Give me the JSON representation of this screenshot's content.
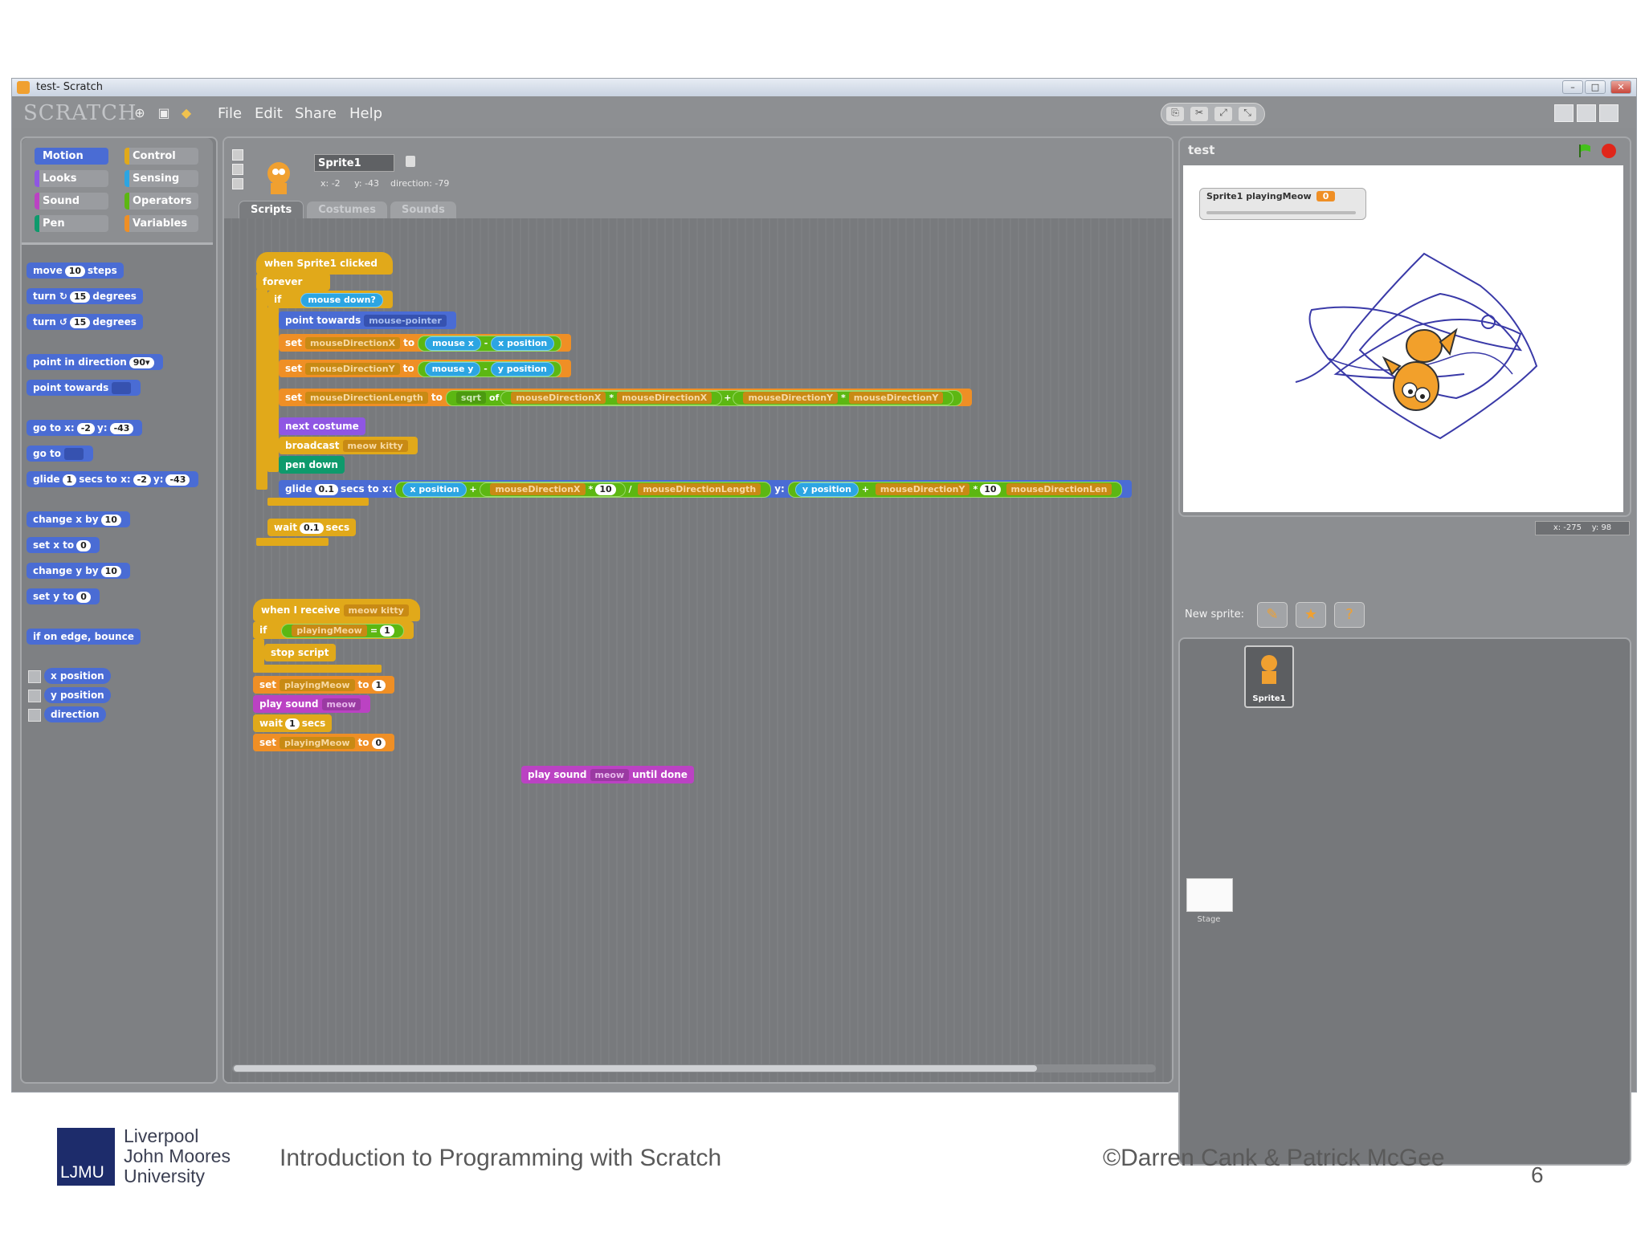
{
  "window": {
    "title": "test- Scratch"
  },
  "menubar": {
    "logo": "SCRATCH",
    "items": [
      "File",
      "Edit",
      "Share",
      "Help"
    ]
  },
  "categories": {
    "motion": "Motion",
    "control": "Control",
    "looks": "Looks",
    "sensing": "Sensing",
    "sound": "Sound",
    "operators": "Operators",
    "pen": "Pen",
    "variables": "Variables"
  },
  "palette": {
    "move": "move",
    "move_val": "10",
    "move_end": "steps",
    "turn_r": "turn ↻",
    "turn_r_val": "15",
    "turn_r_end": "degrees",
    "turn_l": "turn ↺",
    "turn_l_val": "15",
    "turn_l_end": "degrees",
    "point_dir": "point in direction",
    "point_dir_val": "90▾",
    "point_towards": "point towards",
    "goto": "go to x:",
    "goto_x": "-2",
    "goto_y_lbl": "y:",
    "goto_y": "-43",
    "goto_obj": "go to",
    "glide": "glide",
    "glide_secs": "1",
    "glide_mid": "secs to x:",
    "glide_x": "-2",
    "glide_y_lbl": "y:",
    "glide_y": "-43",
    "change_x": "change x by",
    "change_x_val": "10",
    "set_x": "set x to",
    "set_x_val": "0",
    "change_y": "change y by",
    "change_y_val": "10",
    "set_y": "set y to",
    "set_y_val": "0",
    "bounce": "if on edge, bounce",
    "rep_x": "x position",
    "rep_y": "y position",
    "rep_dir": "direction"
  },
  "sprite": {
    "name": "Sprite1",
    "info": "x: -2     y: -43    direction: -79"
  },
  "tabs": {
    "scripts": "Scripts",
    "costumes": "Costumes",
    "sounds": "Sounds"
  },
  "script1": {
    "hat": "when Sprite1 clicked",
    "forever": "forever",
    "if": "if",
    "mouse_down": "mouse down?",
    "point_towards": "point towards",
    "mouse_pointer": "mouse-pointer",
    "set": "set",
    "to": "to",
    "var_dx": "mouseDirectionX",
    "var_dy": "mouseDirectionY",
    "var_len": "mouseDirectionLength",
    "mouse_x": "mouse x",
    "x_position": "x position",
    "mouse_y": "mouse y",
    "y_position": "y position",
    "sqrt": "sqrt",
    "of": "of",
    "op_mul": "*",
    "op_plus": "+",
    "op_minus": "-",
    "op_div": "/",
    "next_costume": "next costume",
    "broadcast": "broadcast",
    "msg": "meow kitty",
    "pen_down": "pen down",
    "glide": "glide",
    "glide_secs": "0.1",
    "glide_mid": "secs to x:",
    "ten": "10",
    "y_lbl": "y:",
    "truncated": "mouseDirectionLen",
    "wait": "wait",
    "wait_val": "0.1",
    "secs": "secs"
  },
  "script2": {
    "hat": "when I receive",
    "msg": "meow kitty",
    "if": "if",
    "var": "playingMeow",
    "eq": "=",
    "one": "1",
    "stop": "stop script",
    "set": "set",
    "to": "to",
    "set_val1": "1",
    "play": "play sound",
    "sound": "meow",
    "wait": "wait",
    "wait_val": "1",
    "secs": "secs",
    "set_val0": "0"
  },
  "script3": {
    "play": "play sound",
    "sound": "meow",
    "until": "until done"
  },
  "stage": {
    "title": "test",
    "monitor_label": "Sprite1 playingMeow",
    "monitor_value": "0",
    "coords": "x: -275    y: 98"
  },
  "new_sprite_label": "New sprite:",
  "sprite_list": {
    "sprite1": "Sprite1",
    "stage": "Stage"
  },
  "footer": {
    "logo_line1": "Liverpool",
    "logo_line2": "John Moores",
    "logo_line3": "University",
    "logo_mark": "LJMU",
    "course": "Introduction to Programming with Scratch",
    "copyright": "©Darren Cank & Patrick McGee",
    "page": "6"
  },
  "colors": {
    "motion": "#4a6cd4",
    "control": "#e1a91a",
    "variables": "#ef8f25",
    "operators": "#5cb712",
    "looks": "#8f56e3",
    "sound": "#bb42c3",
    "pen": "#0e9a6c",
    "sensing": "#2ca5e2"
  }
}
